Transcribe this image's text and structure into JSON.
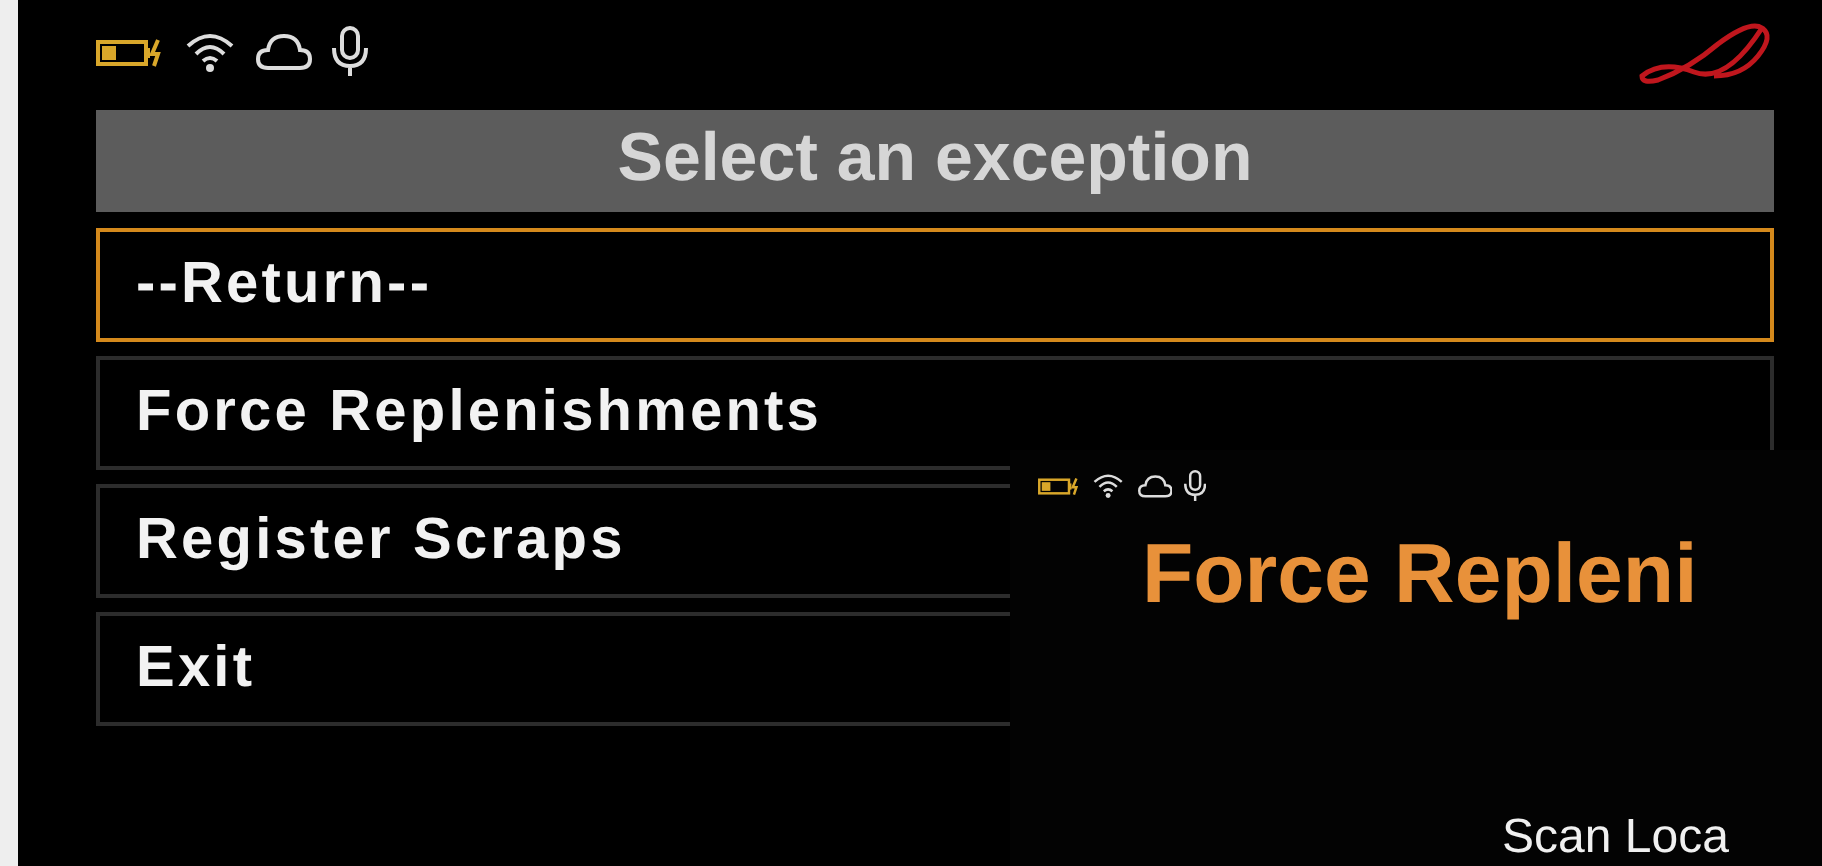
{
  "header": {
    "title": "Select an exception"
  },
  "menu": [
    {
      "label": "--Return--",
      "selected": true
    },
    {
      "label": "Force Replenishments",
      "selected": false
    },
    {
      "label": "Register Scraps",
      "selected": false
    },
    {
      "label": "Exit",
      "selected": false
    }
  ],
  "overlay": {
    "title": "Force Repleni",
    "prompt": "Scan Loca"
  }
}
